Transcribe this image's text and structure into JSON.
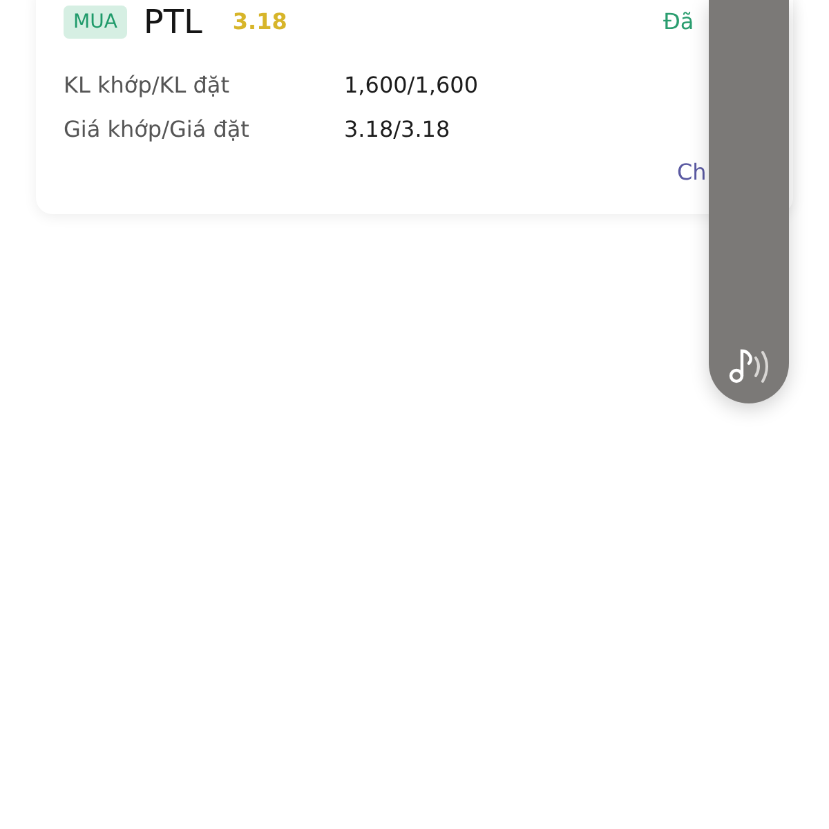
{
  "order": {
    "side": {
      "label": "MUA",
      "kind": "buy"
    },
    "symbol": "PTL",
    "price": "3.18",
    "status": "Đã",
    "details": [
      {
        "label": "KL khớp/KL đặt",
        "value": "1,600/1,600"
      },
      {
        "label": "Giá khớp/Giá đặt",
        "value": "3.18/3.18"
      }
    ],
    "action": "Ch"
  }
}
